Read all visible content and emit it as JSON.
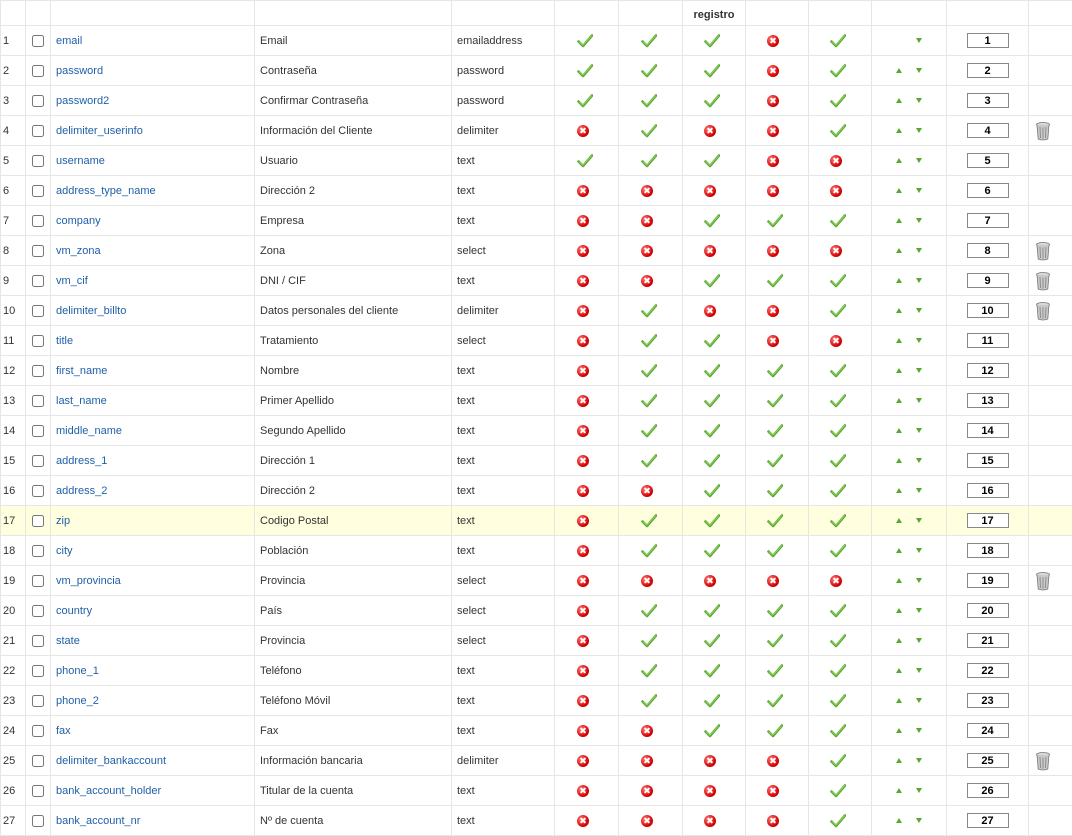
{
  "header": {
    "registro_label": "registro"
  },
  "rows": [
    {
      "n": "1",
      "name": "email",
      "title": "Email",
      "type": "emailaddress",
      "c": [
        1,
        1,
        1,
        0,
        1
      ],
      "up": false,
      "down": true,
      "order": "1",
      "del": false
    },
    {
      "n": "2",
      "name": "password",
      "title": "Contraseña",
      "type": "password",
      "c": [
        1,
        1,
        1,
        0,
        1
      ],
      "up": true,
      "down": true,
      "order": "2",
      "del": false
    },
    {
      "n": "3",
      "name": "password2",
      "title": "Confirmar Contraseña",
      "type": "password",
      "c": [
        1,
        1,
        1,
        0,
        1
      ],
      "up": true,
      "down": true,
      "order": "3",
      "del": false
    },
    {
      "n": "4",
      "name": "delimiter_userinfo",
      "title": "Información del Cliente",
      "type": "delimiter",
      "c": [
        0,
        1,
        0,
        0,
        1
      ],
      "up": true,
      "down": true,
      "order": "4",
      "del": true
    },
    {
      "n": "5",
      "name": "username",
      "title": "Usuario",
      "type": "text",
      "c": [
        1,
        1,
        1,
        0,
        0
      ],
      "up": true,
      "down": true,
      "order": "5",
      "del": false
    },
    {
      "n": "6",
      "name": "address_type_name",
      "title": "Dirección 2",
      "type": "text",
      "c": [
        0,
        0,
        0,
        0,
        0
      ],
      "up": true,
      "down": true,
      "order": "6",
      "del": false
    },
    {
      "n": "7",
      "name": "company",
      "title": "Empresa",
      "type": "text",
      "c": [
        0,
        0,
        1,
        1,
        1
      ],
      "up": true,
      "down": true,
      "order": "7",
      "del": false
    },
    {
      "n": "8",
      "name": "vm_zona",
      "title": "Zona",
      "type": "select",
      "c": [
        0,
        0,
        0,
        0,
        0
      ],
      "up": true,
      "down": true,
      "order": "8",
      "del": true
    },
    {
      "n": "9",
      "name": "vm_cif",
      "title": "DNI / CIF",
      "type": "text",
      "c": [
        0,
        0,
        1,
        1,
        1
      ],
      "up": true,
      "down": true,
      "order": "9",
      "del": true
    },
    {
      "n": "10",
      "name": "delimiter_billto",
      "title": "Datos personales del cliente",
      "type": "delimiter",
      "c": [
        0,
        1,
        0,
        0,
        1
      ],
      "up": true,
      "down": true,
      "order": "10",
      "del": true
    },
    {
      "n": "11",
      "name": "title",
      "title": "Tratamiento",
      "type": "select",
      "c": [
        0,
        1,
        1,
        0,
        0
      ],
      "up": true,
      "down": true,
      "order": "11",
      "del": false
    },
    {
      "n": "12",
      "name": "first_name",
      "title": "Nombre",
      "type": "text",
      "c": [
        0,
        1,
        1,
        1,
        1
      ],
      "up": true,
      "down": true,
      "order": "12",
      "del": false
    },
    {
      "n": "13",
      "name": "last_name",
      "title": "Primer Apellido",
      "type": "text",
      "c": [
        0,
        1,
        1,
        1,
        1
      ],
      "up": true,
      "down": true,
      "order": "13",
      "del": false
    },
    {
      "n": "14",
      "name": "middle_name",
      "title": "Segundo Apellido",
      "type": "text",
      "c": [
        0,
        1,
        1,
        1,
        1
      ],
      "up": true,
      "down": true,
      "order": "14",
      "del": false
    },
    {
      "n": "15",
      "name": "address_1",
      "title": "Dirección 1",
      "type": "text",
      "c": [
        0,
        1,
        1,
        1,
        1
      ],
      "up": true,
      "down": true,
      "order": "15",
      "del": false
    },
    {
      "n": "16",
      "name": "address_2",
      "title": "Dirección 2",
      "type": "text",
      "c": [
        0,
        0,
        1,
        1,
        1
      ],
      "up": true,
      "down": true,
      "order": "16",
      "del": false
    },
    {
      "n": "17",
      "name": "zip",
      "title": "Codigo Postal",
      "type": "text",
      "c": [
        0,
        1,
        1,
        1,
        1
      ],
      "up": true,
      "down": true,
      "order": "17",
      "del": false,
      "hl": true
    },
    {
      "n": "18",
      "name": "city",
      "title": "Población",
      "type": "text",
      "c": [
        0,
        1,
        1,
        1,
        1
      ],
      "up": true,
      "down": true,
      "order": "18",
      "del": false
    },
    {
      "n": "19",
      "name": "vm_provincia",
      "title": "Provincia",
      "type": "select",
      "c": [
        0,
        0,
        0,
        0,
        0
      ],
      "up": true,
      "down": true,
      "order": "19",
      "del": true
    },
    {
      "n": "20",
      "name": "country",
      "title": "País",
      "type": "select",
      "c": [
        0,
        1,
        1,
        1,
        1
      ],
      "up": true,
      "down": true,
      "order": "20",
      "del": false
    },
    {
      "n": "21",
      "name": "state",
      "title": "Provincia",
      "type": "select",
      "c": [
        0,
        1,
        1,
        1,
        1
      ],
      "up": true,
      "down": true,
      "order": "21",
      "del": false
    },
    {
      "n": "22",
      "name": "phone_1",
      "title": "Teléfono",
      "type": "text",
      "c": [
        0,
        1,
        1,
        1,
        1
      ],
      "up": true,
      "down": true,
      "order": "22",
      "del": false
    },
    {
      "n": "23",
      "name": "phone_2",
      "title": "Teléfono Móvil",
      "type": "text",
      "c": [
        0,
        1,
        1,
        1,
        1
      ],
      "up": true,
      "down": true,
      "order": "23",
      "del": false
    },
    {
      "n": "24",
      "name": "fax",
      "title": "Fax",
      "type": "text",
      "c": [
        0,
        0,
        1,
        1,
        1
      ],
      "up": true,
      "down": true,
      "order": "24",
      "del": false
    },
    {
      "n": "25",
      "name": "delimiter_bankaccount",
      "title": "Información bancaria",
      "type": "delimiter",
      "c": [
        0,
        0,
        0,
        0,
        1
      ],
      "up": true,
      "down": true,
      "order": "25",
      "del": true
    },
    {
      "n": "26",
      "name": "bank_account_holder",
      "title": "Titular de la cuenta",
      "type": "text",
      "c": [
        0,
        0,
        0,
        0,
        1
      ],
      "up": true,
      "down": true,
      "order": "26",
      "del": false
    },
    {
      "n": "27",
      "name": "bank_account_nr",
      "title": "Nº de cuenta",
      "type": "text",
      "c": [
        0,
        0,
        0,
        0,
        1
      ],
      "up": true,
      "down": true,
      "order": "27",
      "del": false
    }
  ],
  "colors": {
    "link": "#1f5fa8",
    "ok_green": "#5aa832",
    "no_red": "#d40000",
    "highlight_row": "#ffffe0"
  },
  "icons": {
    "ok": "check-icon",
    "no": "x-circle-icon",
    "up": "arrow-up-icon",
    "down": "arrow-down-icon",
    "delete": "trash-icon"
  }
}
